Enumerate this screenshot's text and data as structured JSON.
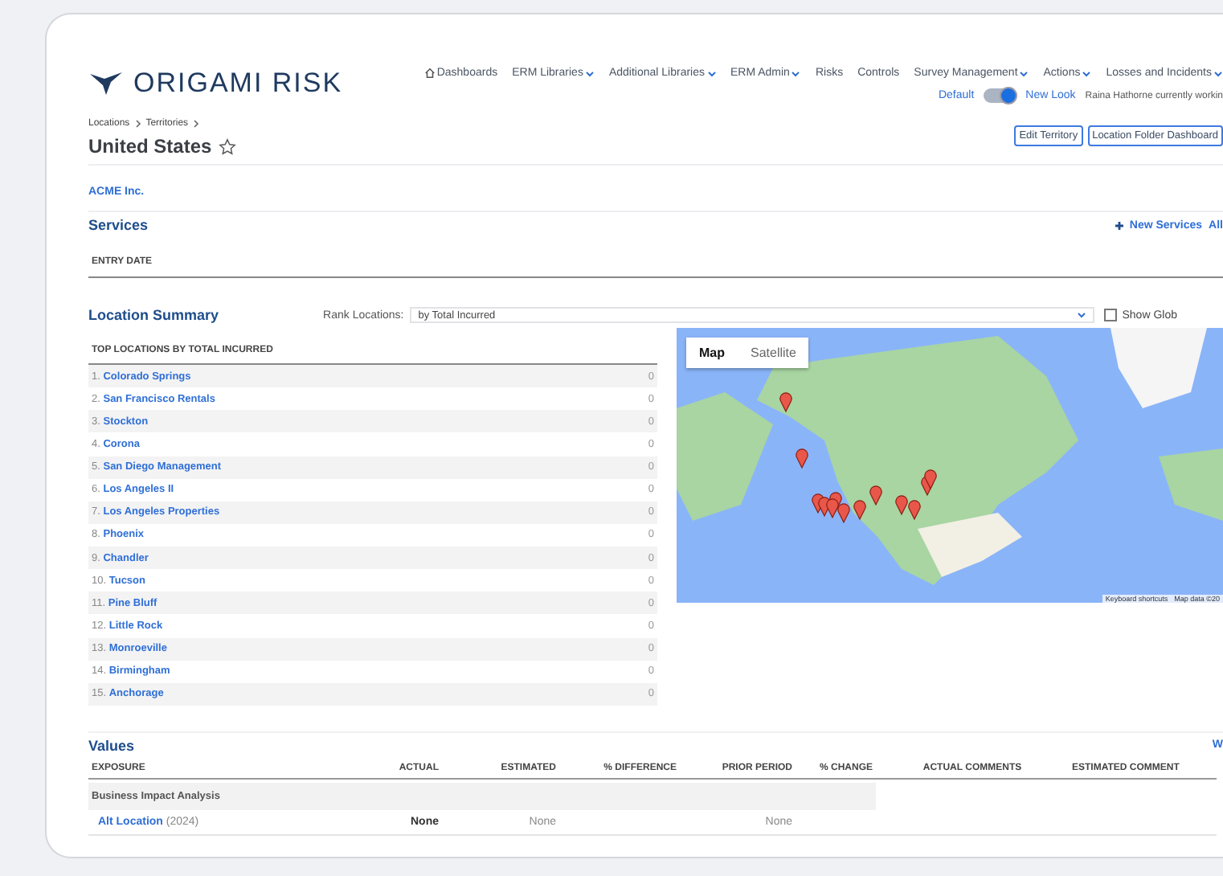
{
  "brand": {
    "name": "ORIGAMI RISK"
  },
  "nav": [
    {
      "kind": "home",
      "label": "Dashboards",
      "dropdown": false
    },
    {
      "kind": "link",
      "label": "ERM Libraries",
      "dropdown": true
    },
    {
      "kind": "link",
      "label": "Additional Libraries",
      "dropdown": true
    },
    {
      "kind": "link",
      "label": "ERM Admin",
      "dropdown": true
    },
    {
      "kind": "link",
      "label": "Risks",
      "dropdown": false
    },
    {
      "kind": "link",
      "label": "Controls",
      "dropdown": false
    },
    {
      "kind": "link",
      "label": "Survey Management",
      "dropdown": true
    },
    {
      "kind": "link",
      "label": "Actions",
      "dropdown": true
    },
    {
      "kind": "link",
      "label": "Losses and Incidents",
      "dropdown": true
    }
  ],
  "look_toggle": {
    "left_label": "Default",
    "right_label": "New Look",
    "on": true
  },
  "user_status": "Raina Hathorne currently workin",
  "breadcrumbs": [
    "Locations",
    "Territories"
  ],
  "page_title": "United States",
  "favorite": false,
  "header_buttons": [
    "Edit Territory",
    "Location Folder Dashboard"
  ],
  "client_link": "ACME Inc.",
  "services": {
    "title": "Services",
    "new_link": "New Services",
    "all_link": "All",
    "column": "ENTRY DATE"
  },
  "location_summary": {
    "title": "Location Summary",
    "rank_label": "Rank Locations:",
    "rank_value": "by Total Incurred",
    "show_global": {
      "label": "Show Glob",
      "checked": false
    },
    "list_title": "TOP LOCATIONS BY TOTAL INCURRED",
    "locations": [
      {
        "rank": "1.",
        "name": "Colorado Springs",
        "value": "0"
      },
      {
        "rank": "2.",
        "name": "San Francisco Rentals",
        "value": "0"
      },
      {
        "rank": "3.",
        "name": "Stockton",
        "value": "0"
      },
      {
        "rank": "4.",
        "name": "Corona",
        "value": "0"
      },
      {
        "rank": "5.",
        "name": "San Diego Management",
        "value": "0"
      },
      {
        "rank": "6.",
        "name": "Los Angeles II",
        "value": "0"
      },
      {
        "rank": "7.",
        "name": "Los Angeles Properties",
        "value": "0"
      },
      {
        "rank": "8.",
        "name": "Phoenix",
        "value": "0"
      },
      {
        "rank": "9.",
        "name": "Chandler",
        "value": "0"
      },
      {
        "rank": "10.",
        "name": "Tucson",
        "value": "0"
      },
      {
        "rank": "11.",
        "name": "Pine Bluff",
        "value": "0"
      },
      {
        "rank": "12.",
        "name": "Little Rock",
        "value": "0"
      },
      {
        "rank": "13.",
        "name": "Monroeville",
        "value": "0"
      },
      {
        "rank": "14.",
        "name": "Birmingham",
        "value": "0"
      },
      {
        "rank": "15.",
        "name": "Anchorage",
        "value": "0"
      }
    ],
    "map": {
      "tabs": [
        {
          "label": "Map",
          "selected": true
        },
        {
          "label": "Satellite",
          "selected": false
        }
      ],
      "footer": [
        "Keyboard shortcuts",
        "Map data ©20"
      ]
    }
  },
  "values": {
    "title": "Values",
    "right_link": "W",
    "columns": [
      "EXPOSURE",
      "ACTUAL",
      "ESTIMATED",
      "% DIFFERENCE",
      "PRIOR PERIOD",
      "% CHANGE",
      "ACTUAL COMMENTS",
      "ESTIMATED COMMENT"
    ],
    "rows": [
      {
        "kind": "group",
        "label": "Business Impact Analysis"
      },
      {
        "kind": "item",
        "name": "Alt Location",
        "year": "(2024)",
        "actual": "None",
        "estimated": "None",
        "prior_period": "None"
      }
    ]
  }
}
